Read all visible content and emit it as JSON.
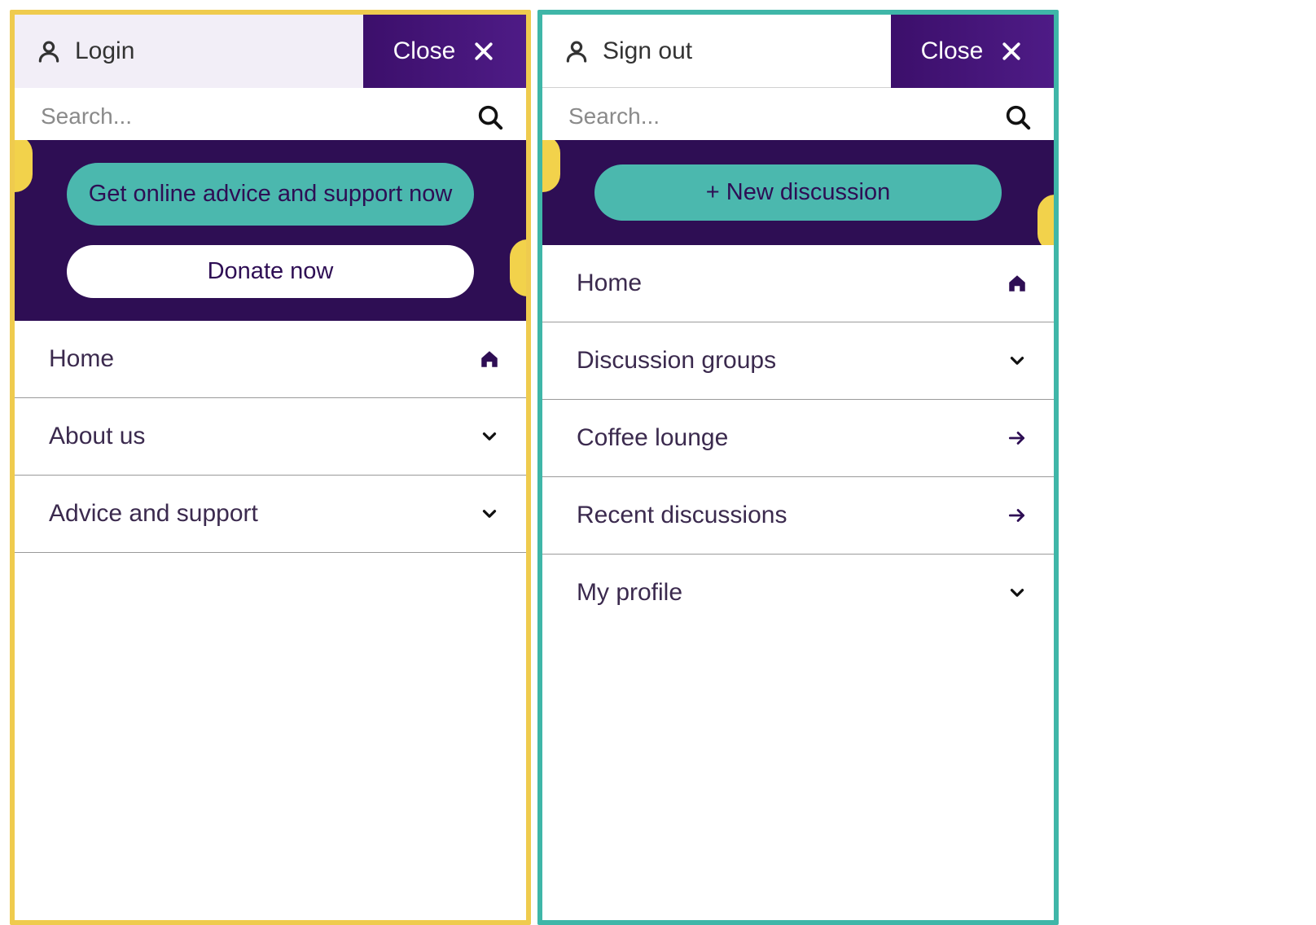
{
  "left": {
    "auth_label": "Login",
    "close_label": "Close",
    "search_placeholder": "Search...",
    "cta_primary": "Get online advice and support now",
    "cta_secondary": "Donate now",
    "nav": [
      {
        "label": "Home",
        "icon": "home"
      },
      {
        "label": "About us",
        "icon": "chevron"
      },
      {
        "label": "Advice and support",
        "icon": "chevron"
      }
    ]
  },
  "right": {
    "auth_label": "Sign out",
    "close_label": "Close",
    "search_placeholder": "Search...",
    "cta_primary": "+ New discussion",
    "nav": [
      {
        "label": "Home",
        "icon": "home"
      },
      {
        "label": "Discussion groups",
        "icon": "chevron"
      },
      {
        "label": "Coffee lounge",
        "icon": "arrow"
      },
      {
        "label": "Recent discussions",
        "icon": "arrow"
      },
      {
        "label": "My profile",
        "icon": "chevron"
      }
    ]
  },
  "colors": {
    "border_yellow": "#EFCB4E",
    "border_teal": "#3FB6A8",
    "hero_bg": "#2E0E54",
    "pill_teal": "#4BB8AE",
    "accent_yellow": "#F2D24B"
  }
}
